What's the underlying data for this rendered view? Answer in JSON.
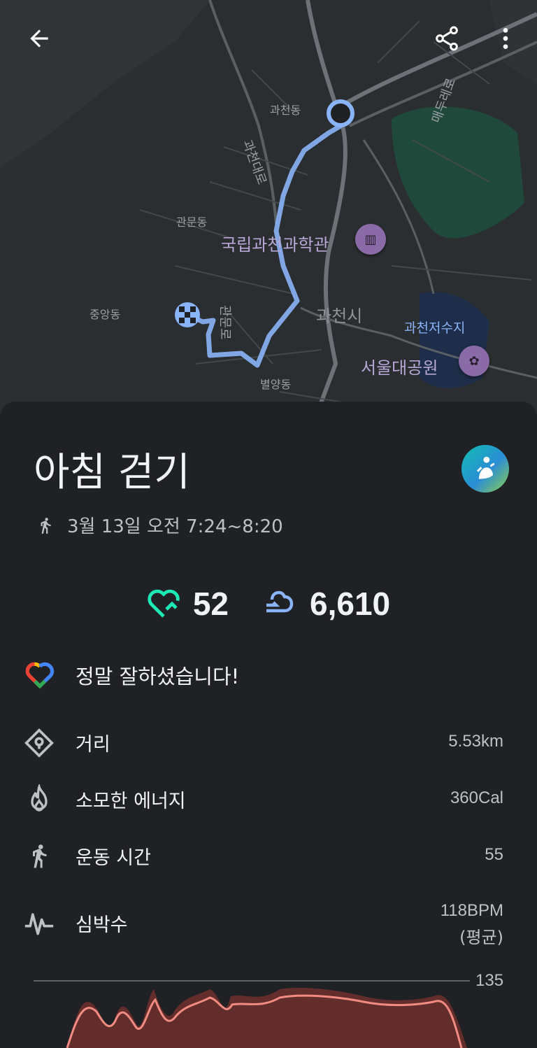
{
  "map": {
    "labels": {
      "gwacheon_dong": "과천동",
      "gwacheon_daero": "과천대로",
      "maedeul_ro": "매두레로",
      "gwanmun_dong": "관문동",
      "science_museum": "국립과천과학관",
      "jungang_dong": "중앙동",
      "gwanmun_ro": "관문로",
      "gwacheon_si": "과천시",
      "reservoir": "과천저수지",
      "grand_park": "서울대공원",
      "byeolyang_dong": "별양동"
    },
    "route_color": "#8ab4f8"
  },
  "topbar": {
    "back_icon": "arrow-left-icon",
    "share_icon": "share-icon",
    "more_icon": "more-vert-icon"
  },
  "activity": {
    "title": "아침 걷기",
    "date_time": "3월 13일 오전 7:24~8:20",
    "heart_points": "52",
    "steps": "6,610",
    "message": "정말 잘하셨습니다!"
  },
  "stats": [
    {
      "label": "거리",
      "value": "5.53km",
      "icon": "location-pin-icon"
    },
    {
      "label": "소모한 에너지",
      "value": "360Cal",
      "icon": "flame-icon"
    },
    {
      "label": "운동 시간",
      "value": "55",
      "icon": "walk-icon"
    },
    {
      "label": "심박수",
      "value": "118BPM",
      "value_sub": "(평균)",
      "icon": "heart-rate-icon"
    }
  ],
  "chart_data": {
    "type": "line",
    "max_label": "135",
    "colors": {
      "line": "#f28b82",
      "band": "#6e2f2c"
    }
  }
}
